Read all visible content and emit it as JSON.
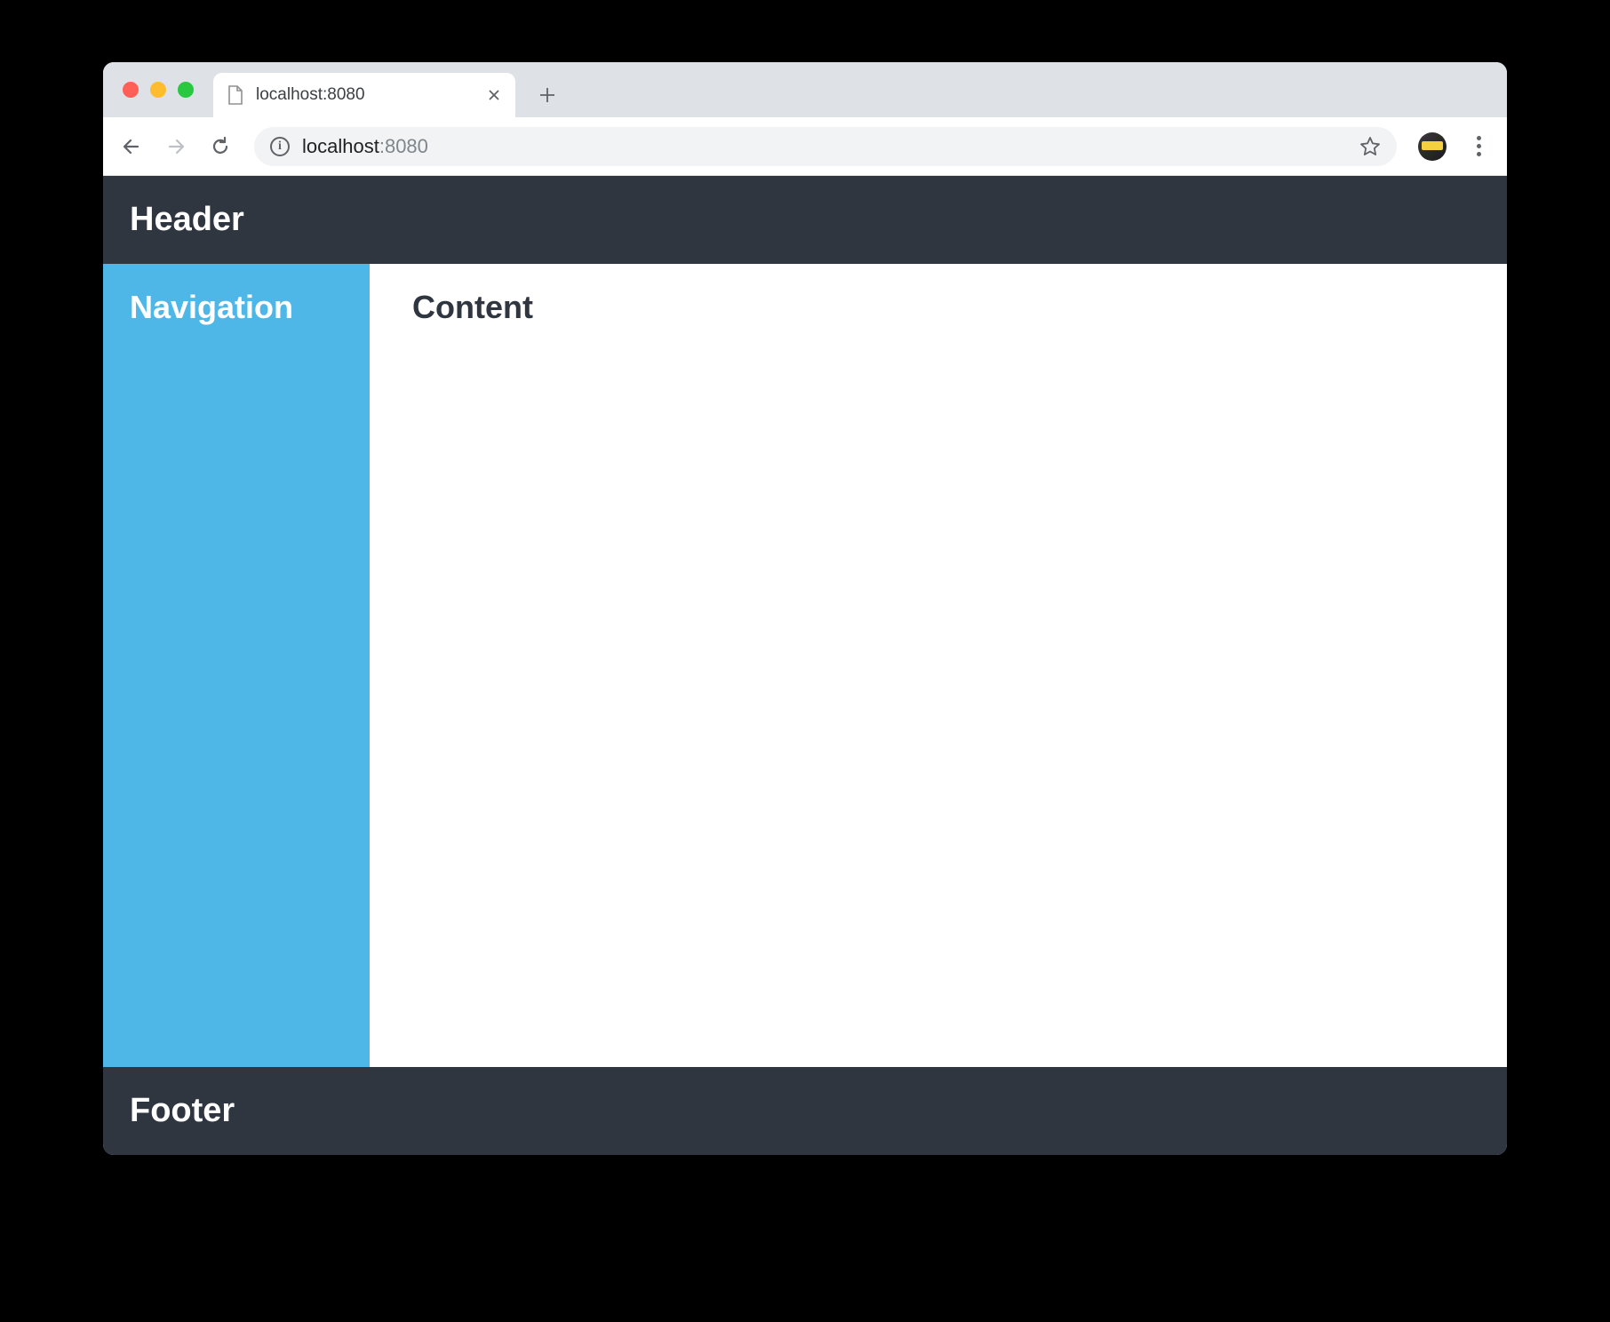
{
  "browser": {
    "tab_title": "localhost:8080",
    "url_host": "localhost",
    "url_port": ":8080"
  },
  "page": {
    "header": "Header",
    "navigation": "Navigation",
    "content": "Content",
    "footer": "Footer"
  }
}
